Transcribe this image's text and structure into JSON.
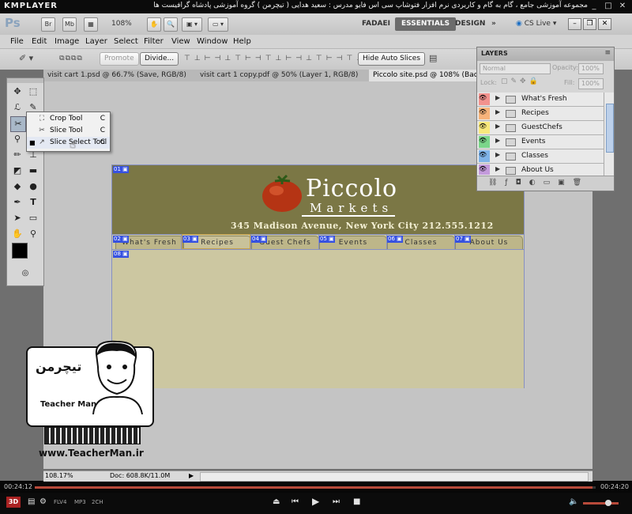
{
  "player": {
    "logo": "KMPLAYER",
    "caption": "مجموعه آموزشی جامع ، گام به گام و کاربردی نرم افزار فتوشاپ سی اس فایو  مدرس : سعید هدایی ( تیچرمن ) گروه آموزشی پادشاه گرافیست ها",
    "time_elapsed": "00:24:12",
    "time_total": "00:24:20",
    "progress_fraction": 0.994,
    "labels": [
      "FLV4",
      "MP3",
      "2CH"
    ],
    "badge": "3D"
  },
  "appbar": {
    "logo": "Ps",
    "br": "Br",
    "mb": "Mb",
    "zoom": "108%",
    "workspaces": [
      "FADAEI",
      "ESSENTIALS",
      "DESIGN"
    ],
    "more": "»",
    "cs_live": "CS Live"
  },
  "menu": [
    "File",
    "Edit",
    "Image",
    "Layer",
    "Select",
    "Filter",
    "View",
    "Window",
    "Help"
  ],
  "options": {
    "promote": "Promote",
    "divide": "Divide...",
    "hide_auto_slices": "Hide Auto Slices"
  },
  "tabs": [
    "visit cart 1.psd @ 66.7% (Save, RGB/8)",
    "visit cart 1 copy.pdf @ 50% (Layer 1, RGB/8)",
    "Piccolo site.psd @ 108% (Bac"
  ],
  "flyout": [
    {
      "label": "Crop Tool",
      "key": "C",
      "icon": "crop-icon",
      "selected": false
    },
    {
      "label": "Slice Tool",
      "key": "C",
      "icon": "slice-icon",
      "selected": false
    },
    {
      "label": "Slice Select Tool",
      "key": "C",
      "icon": "slice-select-icon",
      "selected": true
    }
  ],
  "site": {
    "brand_line1": "Piccolo",
    "brand_line2": "Markets",
    "address": "345 Madison Avenue, New York City  212.555.1212",
    "nav": [
      "What's Fresh",
      "Recipes",
      "Guest Chefs",
      "Events",
      "Classes",
      "About Us"
    ],
    "slice_ids": [
      "01",
      "02",
      "03",
      "04",
      "05",
      "06",
      "07",
      "08"
    ]
  },
  "layers": {
    "title": "LAYERS",
    "blend": "Normal",
    "opacity_label": "Opacity:",
    "opacity": "100%",
    "lock_label": "Lock:",
    "fill_label": "Fill:",
    "fill": "100%",
    "items": [
      {
        "name": "What's Fresh",
        "color": "#f2928e"
      },
      {
        "name": "Recipes",
        "color": "#f6b37a"
      },
      {
        "name": "GuestChefs",
        "color": "#f8e87c"
      },
      {
        "name": "Events",
        "color": "#7bd68a"
      },
      {
        "name": "Classes",
        "color": "#7fb3e8"
      },
      {
        "name": "About Us",
        "color": "#c49bdc"
      }
    ]
  },
  "status": {
    "zoom": "108.17%",
    "doc": "Doc: 608.8K/11.0M"
  },
  "watermark": {
    "name": "Teacher Man",
    "url": "www.TeacherMan.ir"
  }
}
